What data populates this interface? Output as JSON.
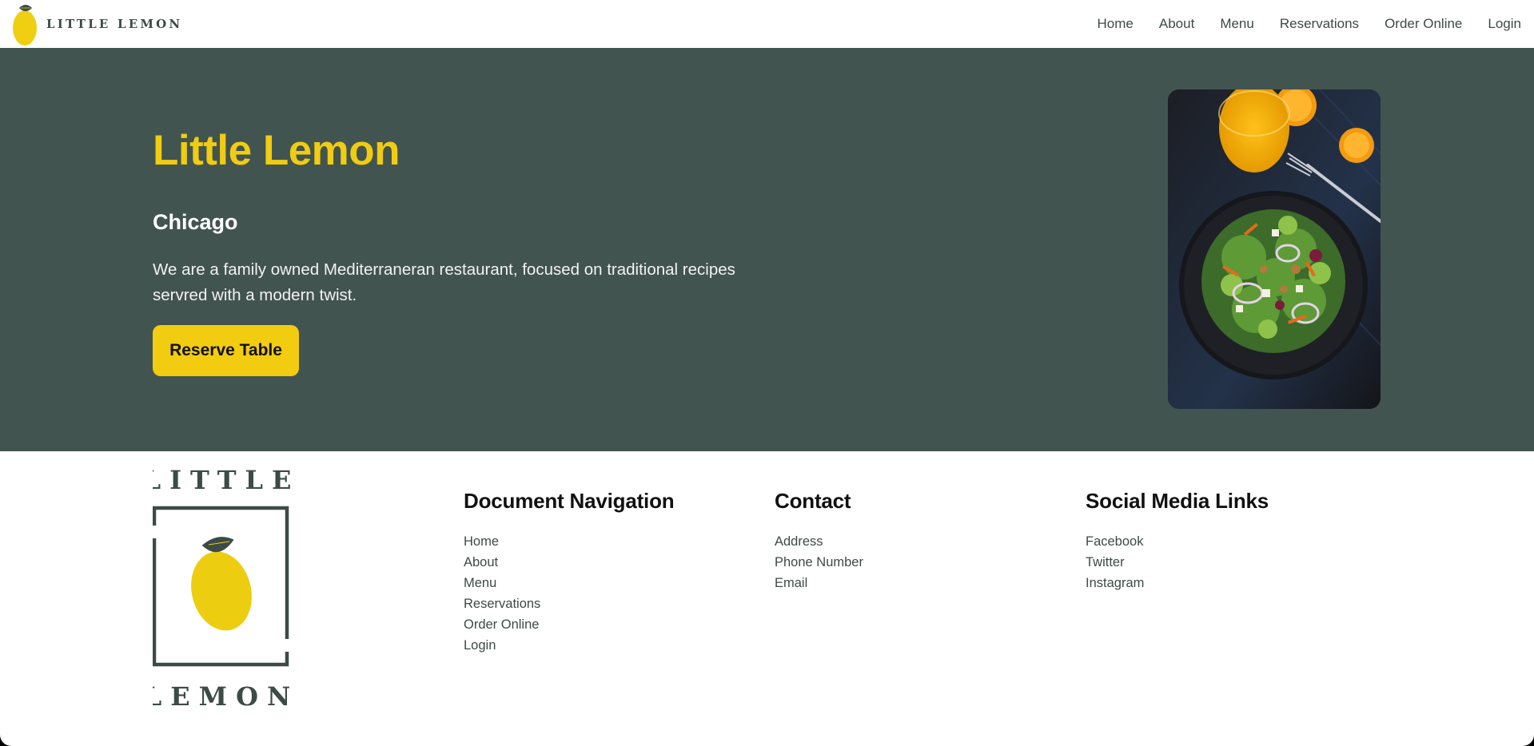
{
  "brand": {
    "name": "LITTLE LEMON"
  },
  "nav": {
    "items": [
      {
        "label": "Home"
      },
      {
        "label": "About"
      },
      {
        "label": "Menu"
      },
      {
        "label": "Reservations"
      },
      {
        "label": "Order Online"
      },
      {
        "label": "Login"
      }
    ]
  },
  "hero": {
    "title": "Little Lemon",
    "subtitle": "Chicago",
    "description": "We are a family owned Mediterraneran restaurant, focused on traditional recipes servred with a modern twist.",
    "cta_label": "Reserve Table"
  },
  "footer": {
    "logo": {
      "top_text": "LITTLE",
      "bottom_text": "LEMON"
    },
    "navigation": {
      "heading": "Document Navigation",
      "items": [
        "Home",
        "About",
        "Menu",
        "Reservations",
        "Order Online",
        "Login"
      ]
    },
    "contact": {
      "heading": "Contact",
      "items": [
        "Address",
        "Phone Number",
        "Email"
      ]
    },
    "social": {
      "heading": "Social Media Links",
      "items": [
        "Facebook",
        "Twitter",
        "Instagram"
      ]
    }
  },
  "colors": {
    "hero_bg": "#425450",
    "accent_yellow": "#f2cc10",
    "dark_green": "#3c4b45"
  }
}
